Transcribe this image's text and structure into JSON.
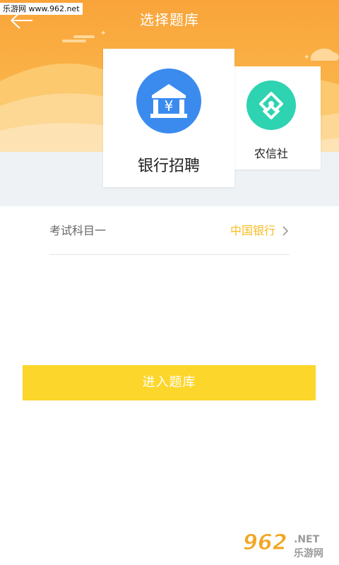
{
  "watermark_top": "乐游网 www.962.net",
  "header": {
    "title": "选择题库",
    "back_icon": "arrow-left-icon"
  },
  "categories": [
    {
      "label": "银行招聘",
      "icon": "bank-icon",
      "icon_color": "#3b8bef",
      "selected": true
    },
    {
      "label": "农信社",
      "icon": "rural-credit-icon",
      "icon_color": "#2ed3b1",
      "selected": false
    }
  ],
  "subject": {
    "label": "考试科目一",
    "value": "中国银行",
    "value_color": "#f6bc22"
  },
  "enter_button": {
    "label": "进入题库",
    "color": "#fcd62a"
  },
  "watermark_logo": {
    "number": "962",
    "net": ".NET",
    "site": "乐游网"
  },
  "colors": {
    "header_top": "#f9a93c",
    "header_bottom": "#fbbd4e",
    "hills": "#fcd79a"
  }
}
